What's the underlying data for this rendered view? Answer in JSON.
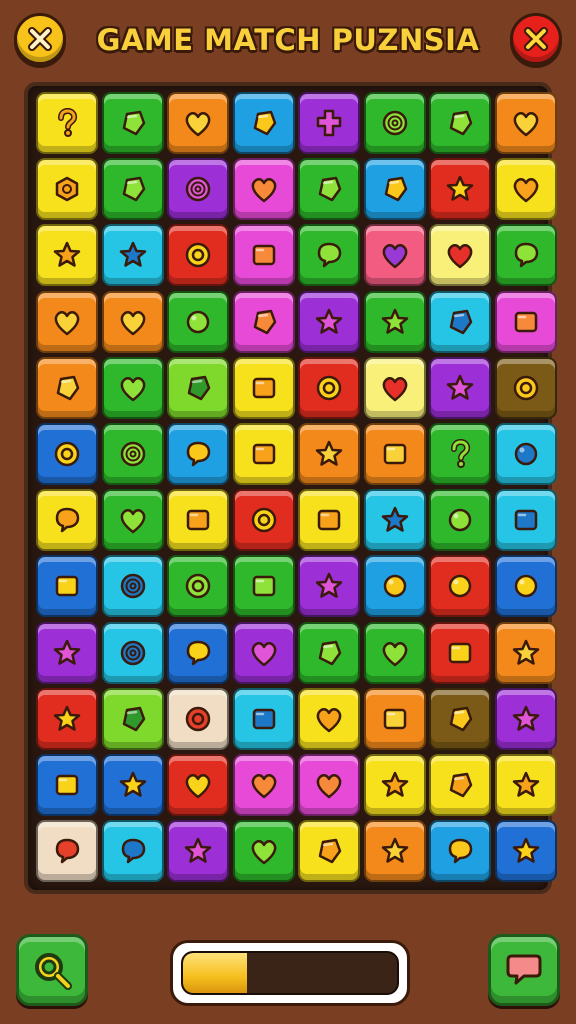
{
  "header": {
    "title": "GAME MATCH  PUZNSIA",
    "left_button_icon": "close-icon",
    "right_button_icon": "close-icon",
    "left_button_color": "#f7c21a",
    "right_button_color": "#e8201c"
  },
  "footer": {
    "left_button_icon": "search-icon",
    "right_button_icon": "chat-icon",
    "progress": 0.3
  },
  "colors": {
    "yellow": "#f7e11d",
    "green": "#2fb82b",
    "orange": "#f4891b",
    "blue": "#1fa0e3",
    "purple": "#9c2fd6",
    "red": "#e12d1f",
    "pink": "#e84ad8",
    "lime": "#7fd92c",
    "cyan": "#27c5e5",
    "dblue": "#2170d6",
    "brown": "#7b5a17",
    "cream": "#f0ddc4",
    "lyellow": "#f9f07a",
    "salmon": "#f25c80"
  },
  "board": {
    "rows": [
      [
        [
          "yellow",
          "question"
        ],
        [
          "green",
          "gem"
        ],
        [
          "orange",
          "heart"
        ],
        [
          "blue",
          "gem"
        ],
        [
          "purple",
          "cross"
        ],
        [
          "green",
          "swirl"
        ],
        [
          "green",
          "gem"
        ],
        [
          "orange",
          "heart"
        ]
      ],
      [
        [
          "yellow",
          "hexagon"
        ],
        [
          "green",
          "gem"
        ],
        [
          "purple",
          "swirl"
        ],
        [
          "pink",
          "heart"
        ],
        [
          "green",
          "gem"
        ],
        [
          "blue",
          "gem"
        ],
        [
          "red",
          "star"
        ],
        [
          "yellow",
          "heart"
        ]
      ],
      [
        [
          "yellow",
          "star"
        ],
        [
          "cyan",
          "star"
        ],
        [
          "red",
          "ring"
        ],
        [
          "pink",
          "square"
        ],
        [
          "green",
          "bubble"
        ],
        [
          "salmon",
          "heart"
        ],
        [
          "lyellow",
          "heart"
        ],
        [
          "green",
          "bubble"
        ]
      ],
      [
        [
          "orange",
          "heart"
        ],
        [
          "orange",
          "heart"
        ],
        [
          "green",
          "circle"
        ],
        [
          "pink",
          "gem"
        ],
        [
          "purple",
          "star"
        ],
        [
          "green",
          "star"
        ],
        [
          "cyan",
          "gem"
        ],
        [
          "pink",
          "square"
        ]
      ],
      [
        [
          "orange",
          "gem"
        ],
        [
          "green",
          "heart"
        ],
        [
          "lime",
          "gem"
        ],
        [
          "yellow",
          "square"
        ],
        [
          "red",
          "ring"
        ],
        [
          "lyellow",
          "heart"
        ],
        [
          "purple",
          "star"
        ],
        [
          "brown",
          "ring"
        ]
      ],
      [
        [
          "dblue",
          "ring"
        ],
        [
          "green",
          "swirl"
        ],
        [
          "blue",
          "bubble"
        ],
        [
          "yellow",
          "square"
        ],
        [
          "orange",
          "star"
        ],
        [
          "orange",
          "square"
        ],
        [
          "green",
          "question"
        ],
        [
          "cyan",
          "circle"
        ]
      ],
      [
        [
          "yellow",
          "bubble"
        ],
        [
          "green",
          "heart"
        ],
        [
          "yellow",
          "square"
        ],
        [
          "red",
          "ring"
        ],
        [
          "yellow",
          "square"
        ],
        [
          "cyan",
          "star"
        ],
        [
          "green",
          "circle"
        ],
        [
          "cyan",
          "square"
        ]
      ],
      [
        [
          "dblue",
          "square"
        ],
        [
          "cyan",
          "swirl"
        ],
        [
          "green",
          "ring"
        ],
        [
          "green",
          "square"
        ],
        [
          "purple",
          "star"
        ],
        [
          "blue",
          "circle"
        ],
        [
          "red",
          "circle"
        ],
        [
          "dblue",
          "circle"
        ]
      ],
      [
        [
          "purple",
          "star"
        ],
        [
          "cyan",
          "swirl"
        ],
        [
          "dblue",
          "bubble"
        ],
        [
          "purple",
          "heart"
        ],
        [
          "green",
          "gem"
        ],
        [
          "green",
          "heart"
        ],
        [
          "red",
          "square"
        ],
        [
          "orange",
          "star"
        ]
      ],
      [
        [
          "red",
          "star"
        ],
        [
          "lime",
          "gem"
        ],
        [
          "cream",
          "ring"
        ],
        [
          "cyan",
          "square"
        ],
        [
          "yellow",
          "heart"
        ],
        [
          "orange",
          "square"
        ],
        [
          "brown",
          "gem"
        ],
        [
          "purple",
          "star"
        ]
      ],
      [
        [
          "dblue",
          "square"
        ],
        [
          "dblue",
          "star"
        ],
        [
          "red",
          "heart"
        ],
        [
          "pink",
          "heart"
        ],
        [
          "pink",
          "heart"
        ],
        [
          "yellow",
          "star"
        ],
        [
          "yellow",
          "gem"
        ],
        [
          "yellow",
          "star"
        ]
      ],
      [
        [
          "cream",
          "bubble"
        ],
        [
          "cyan",
          "bubble"
        ],
        [
          "purple",
          "star"
        ],
        [
          "green",
          "heart"
        ],
        [
          "yellow",
          "gem"
        ],
        [
          "orange",
          "star"
        ],
        [
          "blue",
          "bubble"
        ],
        [
          "dblue",
          "star"
        ]
      ]
    ]
  }
}
